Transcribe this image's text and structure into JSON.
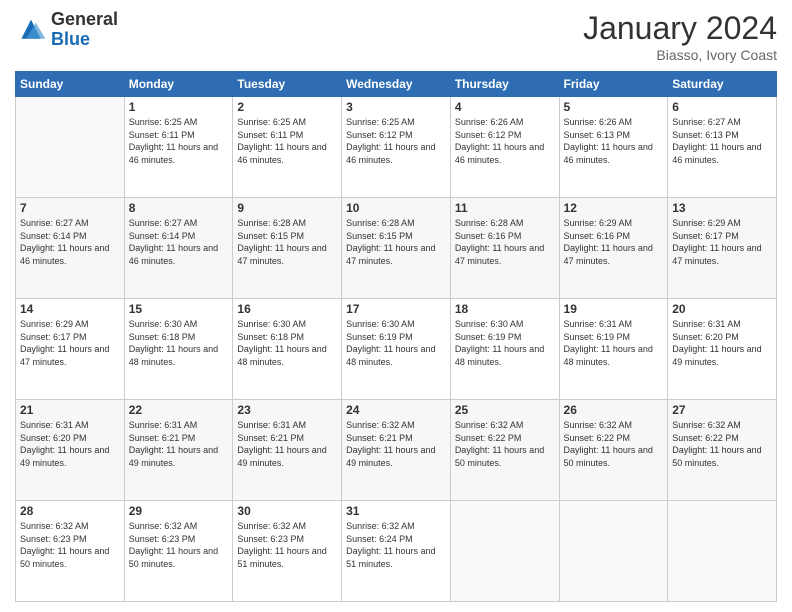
{
  "logo": {
    "general": "General",
    "blue": "Blue"
  },
  "header": {
    "month": "January 2024",
    "location": "Biasso, Ivory Coast"
  },
  "weekdays": [
    "Sunday",
    "Monday",
    "Tuesday",
    "Wednesday",
    "Thursday",
    "Friday",
    "Saturday"
  ],
  "weeks": [
    [
      {
        "day": "",
        "info": ""
      },
      {
        "day": "1",
        "info": "Sunrise: 6:25 AM\nSunset: 6:11 PM\nDaylight: 11 hours and 46 minutes."
      },
      {
        "day": "2",
        "info": "Sunrise: 6:25 AM\nSunset: 6:11 PM\nDaylight: 11 hours and 46 minutes."
      },
      {
        "day": "3",
        "info": "Sunrise: 6:25 AM\nSunset: 6:12 PM\nDaylight: 11 hours and 46 minutes."
      },
      {
        "day": "4",
        "info": "Sunrise: 6:26 AM\nSunset: 6:12 PM\nDaylight: 11 hours and 46 minutes."
      },
      {
        "day": "5",
        "info": "Sunrise: 6:26 AM\nSunset: 6:13 PM\nDaylight: 11 hours and 46 minutes."
      },
      {
        "day": "6",
        "info": "Sunrise: 6:27 AM\nSunset: 6:13 PM\nDaylight: 11 hours and 46 minutes."
      }
    ],
    [
      {
        "day": "7",
        "info": "Sunrise: 6:27 AM\nSunset: 6:14 PM\nDaylight: 11 hours and 46 minutes."
      },
      {
        "day": "8",
        "info": "Sunrise: 6:27 AM\nSunset: 6:14 PM\nDaylight: 11 hours and 46 minutes."
      },
      {
        "day": "9",
        "info": "Sunrise: 6:28 AM\nSunset: 6:15 PM\nDaylight: 11 hours and 47 minutes."
      },
      {
        "day": "10",
        "info": "Sunrise: 6:28 AM\nSunset: 6:15 PM\nDaylight: 11 hours and 47 minutes."
      },
      {
        "day": "11",
        "info": "Sunrise: 6:28 AM\nSunset: 6:16 PM\nDaylight: 11 hours and 47 minutes."
      },
      {
        "day": "12",
        "info": "Sunrise: 6:29 AM\nSunset: 6:16 PM\nDaylight: 11 hours and 47 minutes."
      },
      {
        "day": "13",
        "info": "Sunrise: 6:29 AM\nSunset: 6:17 PM\nDaylight: 11 hours and 47 minutes."
      }
    ],
    [
      {
        "day": "14",
        "info": "Sunrise: 6:29 AM\nSunset: 6:17 PM\nDaylight: 11 hours and 47 minutes."
      },
      {
        "day": "15",
        "info": "Sunrise: 6:30 AM\nSunset: 6:18 PM\nDaylight: 11 hours and 48 minutes."
      },
      {
        "day": "16",
        "info": "Sunrise: 6:30 AM\nSunset: 6:18 PM\nDaylight: 11 hours and 48 minutes."
      },
      {
        "day": "17",
        "info": "Sunrise: 6:30 AM\nSunset: 6:19 PM\nDaylight: 11 hours and 48 minutes."
      },
      {
        "day": "18",
        "info": "Sunrise: 6:30 AM\nSunset: 6:19 PM\nDaylight: 11 hours and 48 minutes."
      },
      {
        "day": "19",
        "info": "Sunrise: 6:31 AM\nSunset: 6:19 PM\nDaylight: 11 hours and 48 minutes."
      },
      {
        "day": "20",
        "info": "Sunrise: 6:31 AM\nSunset: 6:20 PM\nDaylight: 11 hours and 49 minutes."
      }
    ],
    [
      {
        "day": "21",
        "info": "Sunrise: 6:31 AM\nSunset: 6:20 PM\nDaylight: 11 hours and 49 minutes."
      },
      {
        "day": "22",
        "info": "Sunrise: 6:31 AM\nSunset: 6:21 PM\nDaylight: 11 hours and 49 minutes."
      },
      {
        "day": "23",
        "info": "Sunrise: 6:31 AM\nSunset: 6:21 PM\nDaylight: 11 hours and 49 minutes."
      },
      {
        "day": "24",
        "info": "Sunrise: 6:32 AM\nSunset: 6:21 PM\nDaylight: 11 hours and 49 minutes."
      },
      {
        "day": "25",
        "info": "Sunrise: 6:32 AM\nSunset: 6:22 PM\nDaylight: 11 hours and 50 minutes."
      },
      {
        "day": "26",
        "info": "Sunrise: 6:32 AM\nSunset: 6:22 PM\nDaylight: 11 hours and 50 minutes."
      },
      {
        "day": "27",
        "info": "Sunrise: 6:32 AM\nSunset: 6:22 PM\nDaylight: 11 hours and 50 minutes."
      }
    ],
    [
      {
        "day": "28",
        "info": "Sunrise: 6:32 AM\nSunset: 6:23 PM\nDaylight: 11 hours and 50 minutes."
      },
      {
        "day": "29",
        "info": "Sunrise: 6:32 AM\nSunset: 6:23 PM\nDaylight: 11 hours and 50 minutes."
      },
      {
        "day": "30",
        "info": "Sunrise: 6:32 AM\nSunset: 6:23 PM\nDaylight: 11 hours and 51 minutes."
      },
      {
        "day": "31",
        "info": "Sunrise: 6:32 AM\nSunset: 6:24 PM\nDaylight: 11 hours and 51 minutes."
      },
      {
        "day": "",
        "info": ""
      },
      {
        "day": "",
        "info": ""
      },
      {
        "day": "",
        "info": ""
      }
    ]
  ]
}
